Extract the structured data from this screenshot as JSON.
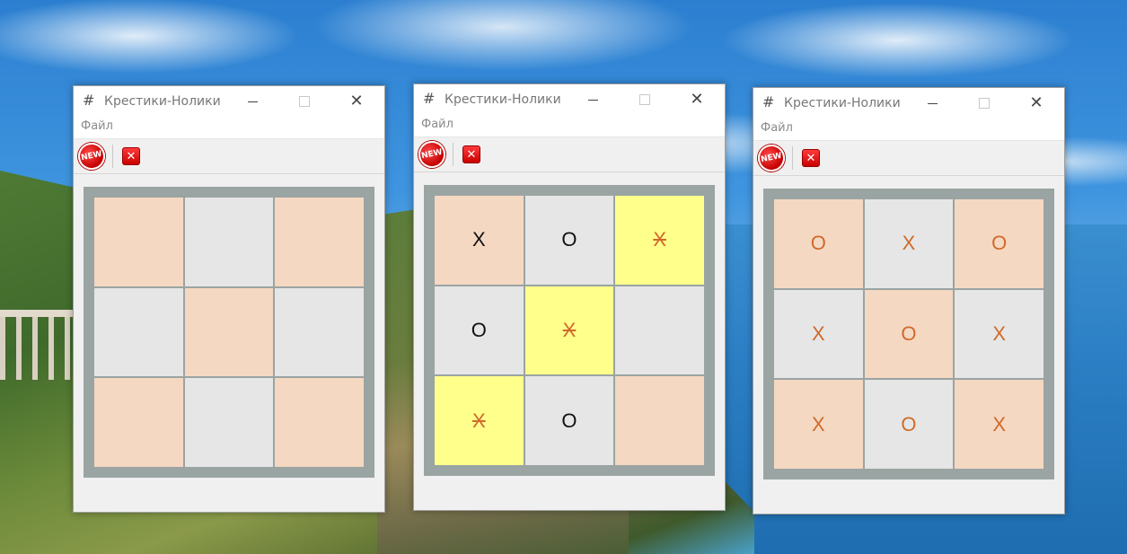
{
  "app": {
    "title": "Крестики-Нолики",
    "menu_file": "Файл",
    "new_button_text": "NEW",
    "close_button_text": "✕",
    "app_icon": "#"
  },
  "colors": {
    "board_frame": "#9aa4a2",
    "cell_peach": "#f5d8c2",
    "cell_grey": "#e6e6e6",
    "cell_win": "#ffff8c",
    "mark_dark": "#111111",
    "mark_orange": "#d06a2a"
  },
  "icons": {
    "app": "grid-hash-icon",
    "new_game": "new-badge-icon",
    "exit": "red-close-icon"
  },
  "windows": [
    {
      "cells": [
        "",
        "",
        "",
        "",
        "",
        "",
        "",
        "",
        ""
      ]
    },
    {
      "cells": [
        "X",
        "O",
        "X",
        "O",
        "X",
        "",
        "X",
        "O",
        ""
      ]
    },
    {
      "cells": [
        "O",
        "X",
        "O",
        "X",
        "O",
        "X",
        "X",
        "O",
        "X"
      ]
    }
  ]
}
